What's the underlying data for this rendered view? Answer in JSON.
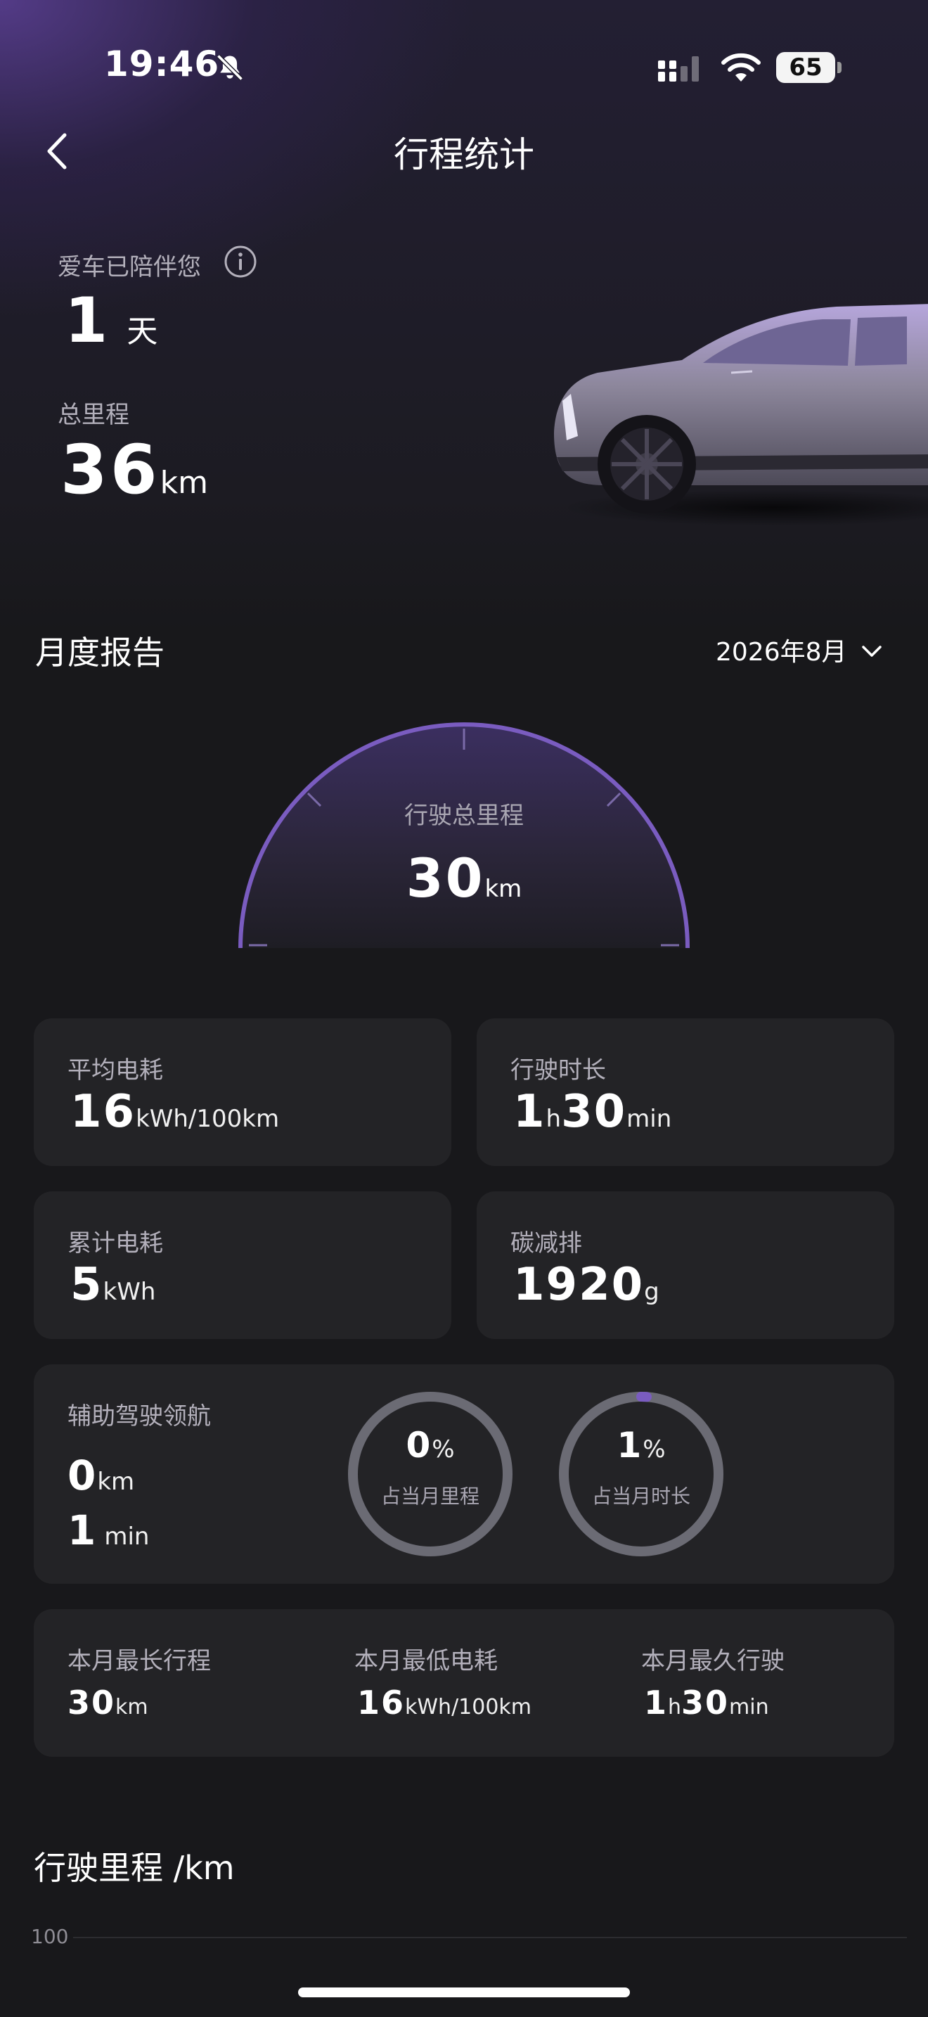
{
  "status_bar": {
    "time": "19:46",
    "battery": "65"
  },
  "header": {
    "title": "行程统计"
  },
  "hero": {
    "companion_label": "爱车已陪伴您",
    "companion_value": "1",
    "companion_unit": "天",
    "total_label": "总里程",
    "total_value": "36",
    "total_unit": "km"
  },
  "monthly": {
    "title": "月度报告",
    "selector": "2026年8月",
    "gauge_label": "行驶总里程",
    "gauge_value": "30",
    "gauge_unit": "km"
  },
  "cards": {
    "avg_consumption": {
      "label": "平均电耗",
      "value": "16",
      "unit": "kWh/100km"
    },
    "driving_time": {
      "label": "行驶时长",
      "hours": "1",
      "h_unit": "h",
      "minutes": "30",
      "min_unit": "min"
    },
    "total_consumption": {
      "label": "累计电耗",
      "value": "5",
      "unit": "kWh"
    },
    "carbon": {
      "label": "碳减排",
      "value": "1920",
      "unit": "g"
    }
  },
  "assist": {
    "label": "辅助驾驶领航",
    "distance": "0",
    "distance_unit": "km",
    "time": "1",
    "time_unit": "min",
    "ring1": {
      "value": "0",
      "unit": "%",
      "caption": "占当月里程",
      "fraction": 0.0
    },
    "ring2": {
      "value": "1",
      "unit": "%",
      "caption": "占当月时长",
      "fraction": 0.01
    }
  },
  "records": {
    "longest_trip": {
      "label": "本月最长行程",
      "value": "30",
      "unit": "km"
    },
    "lowest_consumption": {
      "label": "本月最低电耗",
      "value": "16",
      "unit": "kWh/100km"
    },
    "longest_drive": {
      "label": "本月最久行驶",
      "hours": "1",
      "h_unit": "h",
      "minutes": "30",
      "min_unit": "min"
    }
  },
  "chart": {
    "title": "行驶里程 /km",
    "tick_top": "100"
  },
  "colors": {
    "accent": "#7a5cc0",
    "ring_track": "#6b6b74",
    "card_bg": "#232326"
  }
}
